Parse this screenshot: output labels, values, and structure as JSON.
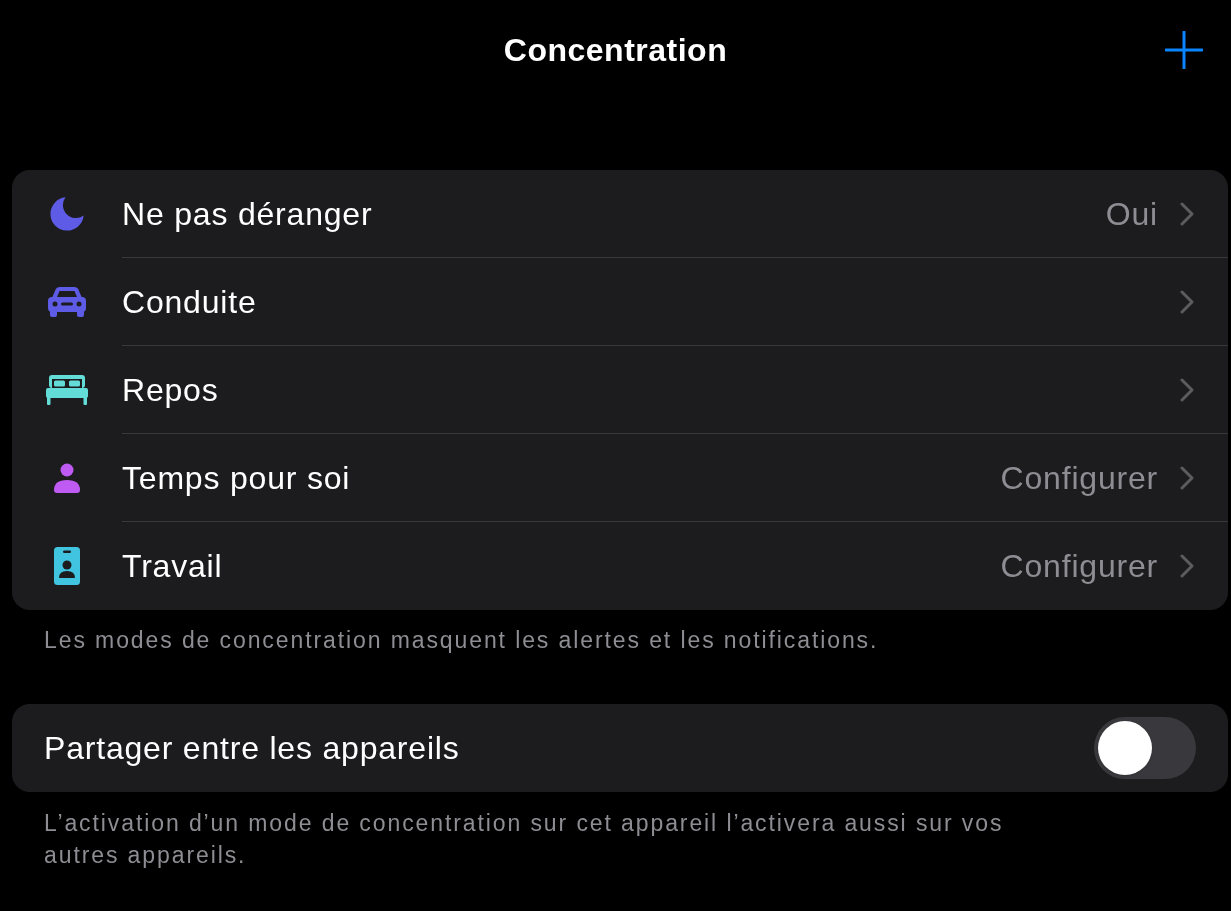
{
  "navigation_bar": {
    "title": "Concentration"
  },
  "focus_modes": {
    "items": [
      {
        "label": "Ne pas déranger",
        "value": "Oui",
        "color": "#5e5ce6"
      },
      {
        "label": "Conduite",
        "color": "#5e5ce6"
      },
      {
        "label": "Repos",
        "color": "#63dcd8"
      },
      {
        "label": "Temps pour soi",
        "value": "Configurer",
        "color": "#bf5af2"
      },
      {
        "label": "Travail",
        "value": "Configurer",
        "color": "#40c4e0"
      }
    ],
    "footer": "Les modes de concentration masquent les alertes et les notifications."
  },
  "share_across_devices": {
    "label": "Partager entre les appareils",
    "on": false,
    "footer": "L’activation d’un mode de concentration sur cet appareil l’activera aussi sur vos autres appareils."
  }
}
